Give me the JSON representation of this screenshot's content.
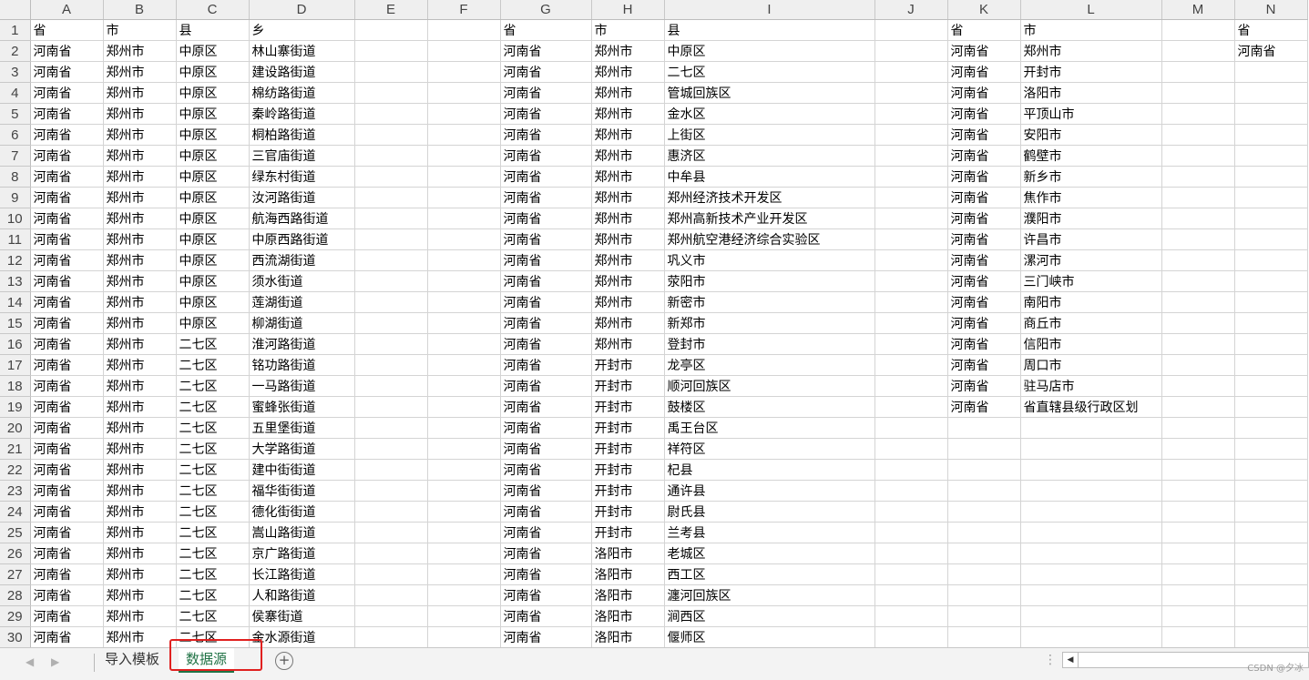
{
  "columns": [
    "A",
    "B",
    "C",
    "D",
    "E",
    "F",
    "G",
    "H",
    "I",
    "J",
    "K",
    "L",
    "M",
    "N"
  ],
  "rows": [
    [
      "省",
      "市",
      "县",
      "乡",
      "",
      "",
      "省",
      "市",
      "县",
      "",
      "省",
      "市",
      "",
      "省"
    ],
    [
      "河南省",
      "郑州市",
      "中原区",
      "林山寨街道",
      "",
      "",
      "河南省",
      "郑州市",
      "中原区",
      "",
      "河南省",
      "郑州市",
      "",
      "河南省"
    ],
    [
      "河南省",
      "郑州市",
      "中原区",
      "建设路街道",
      "",
      "",
      "河南省",
      "郑州市",
      "二七区",
      "",
      "河南省",
      "开封市",
      "",
      ""
    ],
    [
      "河南省",
      "郑州市",
      "中原区",
      "棉纺路街道",
      "",
      "",
      "河南省",
      "郑州市",
      "管城回族区",
      "",
      "河南省",
      "洛阳市",
      "",
      ""
    ],
    [
      "河南省",
      "郑州市",
      "中原区",
      "秦岭路街道",
      "",
      "",
      "河南省",
      "郑州市",
      "金水区",
      "",
      "河南省",
      "平顶山市",
      "",
      ""
    ],
    [
      "河南省",
      "郑州市",
      "中原区",
      "桐柏路街道",
      "",
      "",
      "河南省",
      "郑州市",
      "上街区",
      "",
      "河南省",
      "安阳市",
      "",
      ""
    ],
    [
      "河南省",
      "郑州市",
      "中原区",
      "三官庙街道",
      "",
      "",
      "河南省",
      "郑州市",
      "惠济区",
      "",
      "河南省",
      "鹤壁市",
      "",
      ""
    ],
    [
      "河南省",
      "郑州市",
      "中原区",
      "绿东村街道",
      "",
      "",
      "河南省",
      "郑州市",
      "中牟县",
      "",
      "河南省",
      "新乡市",
      "",
      ""
    ],
    [
      "河南省",
      "郑州市",
      "中原区",
      "汝河路街道",
      "",
      "",
      "河南省",
      "郑州市",
      "郑州经济技术开发区",
      "",
      "河南省",
      "焦作市",
      "",
      ""
    ],
    [
      "河南省",
      "郑州市",
      "中原区",
      "航海西路街道",
      "",
      "",
      "河南省",
      "郑州市",
      "郑州高新技术产业开发区",
      "",
      "河南省",
      "濮阳市",
      "",
      ""
    ],
    [
      "河南省",
      "郑州市",
      "中原区",
      "中原西路街道",
      "",
      "",
      "河南省",
      "郑州市",
      "郑州航空港经济综合实验区",
      "",
      "河南省",
      "许昌市",
      "",
      ""
    ],
    [
      "河南省",
      "郑州市",
      "中原区",
      "西流湖街道",
      "",
      "",
      "河南省",
      "郑州市",
      "巩义市",
      "",
      "河南省",
      "漯河市",
      "",
      ""
    ],
    [
      "河南省",
      "郑州市",
      "中原区",
      "须水街道",
      "",
      "",
      "河南省",
      "郑州市",
      "荥阳市",
      "",
      "河南省",
      "三门峡市",
      "",
      ""
    ],
    [
      "河南省",
      "郑州市",
      "中原区",
      "莲湖街道",
      "",
      "",
      "河南省",
      "郑州市",
      "新密市",
      "",
      "河南省",
      "南阳市",
      "",
      ""
    ],
    [
      "河南省",
      "郑州市",
      "中原区",
      "柳湖街道",
      "",
      "",
      "河南省",
      "郑州市",
      "新郑市",
      "",
      "河南省",
      "商丘市",
      "",
      ""
    ],
    [
      "河南省",
      "郑州市",
      "二七区",
      "淮河路街道",
      "",
      "",
      "河南省",
      "郑州市",
      "登封市",
      "",
      "河南省",
      "信阳市",
      "",
      ""
    ],
    [
      "河南省",
      "郑州市",
      "二七区",
      "铭功路街道",
      "",
      "",
      "河南省",
      "开封市",
      "龙亭区",
      "",
      "河南省",
      "周口市",
      "",
      ""
    ],
    [
      "河南省",
      "郑州市",
      "二七区",
      "一马路街道",
      "",
      "",
      "河南省",
      "开封市",
      "顺河回族区",
      "",
      "河南省",
      "驻马店市",
      "",
      ""
    ],
    [
      "河南省",
      "郑州市",
      "二七区",
      "蜜蜂张街道",
      "",
      "",
      "河南省",
      "开封市",
      "鼓楼区",
      "",
      "河南省",
      "省直辖县级行政区划",
      "",
      ""
    ],
    [
      "河南省",
      "郑州市",
      "二七区",
      "五里堡街道",
      "",
      "",
      "河南省",
      "开封市",
      "禹王台区",
      "",
      "",
      "",
      "",
      ""
    ],
    [
      "河南省",
      "郑州市",
      "二七区",
      "大学路街道",
      "",
      "",
      "河南省",
      "开封市",
      "祥符区",
      "",
      "",
      "",
      "",
      ""
    ],
    [
      "河南省",
      "郑州市",
      "二七区",
      "建中街街道",
      "",
      "",
      "河南省",
      "开封市",
      "杞县",
      "",
      "",
      "",
      "",
      ""
    ],
    [
      "河南省",
      "郑州市",
      "二七区",
      "福华街街道",
      "",
      "",
      "河南省",
      "开封市",
      "通许县",
      "",
      "",
      "",
      "",
      ""
    ],
    [
      "河南省",
      "郑州市",
      "二七区",
      "德化街街道",
      "",
      "",
      "河南省",
      "开封市",
      "尉氏县",
      "",
      "",
      "",
      "",
      ""
    ],
    [
      "河南省",
      "郑州市",
      "二七区",
      "嵩山路街道",
      "",
      "",
      "河南省",
      "开封市",
      "兰考县",
      "",
      "",
      "",
      "",
      ""
    ],
    [
      "河南省",
      "郑州市",
      "二七区",
      "京广路街道",
      "",
      "",
      "河南省",
      "洛阳市",
      "老城区",
      "",
      "",
      "",
      "",
      ""
    ],
    [
      "河南省",
      "郑州市",
      "二七区",
      "长江路街道",
      "",
      "",
      "河南省",
      "洛阳市",
      "西工区",
      "",
      "",
      "",
      "",
      ""
    ],
    [
      "河南省",
      "郑州市",
      "二七区",
      "人和路街道",
      "",
      "",
      "河南省",
      "洛阳市",
      "瀍河回族区",
      "",
      "",
      "",
      "",
      ""
    ],
    [
      "河南省",
      "郑州市",
      "二七区",
      "侯寨街道",
      "",
      "",
      "河南省",
      "洛阳市",
      "涧西区",
      "",
      "",
      "",
      "",
      ""
    ],
    [
      "河南省",
      "郑州市",
      "二七区",
      "金水源街道",
      "",
      "",
      "河南省",
      "洛阳市",
      "偃师区",
      "",
      "",
      "",
      "",
      ""
    ]
  ],
  "tabs": [
    {
      "label": "导入模板",
      "active": false
    },
    {
      "label": "数据源",
      "active": true
    }
  ],
  "nav": {
    "prev": "◀",
    "next": "▶"
  },
  "add_sheet": "+",
  "watermark": "CSDN @夕冰"
}
